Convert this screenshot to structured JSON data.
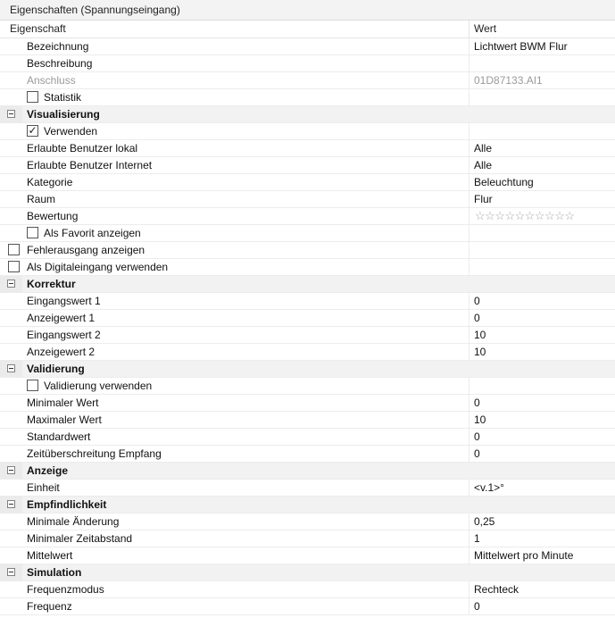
{
  "title": "Eigenschaften (Spannungseingang)",
  "header": {
    "col_property": "Eigenschaft",
    "col_value": "Wert"
  },
  "rows": {
    "bezeichnung": {
      "label": "Bezeichnung",
      "value": "Lichtwert BWM Flur"
    },
    "beschreibung": {
      "label": "Beschreibung",
      "value": ""
    },
    "anschluss": {
      "label": "Anschluss",
      "value": "01D87133.AI1"
    },
    "statistik": {
      "label": "Statistik",
      "checked": false
    },
    "visualisierung": {
      "label": "Visualisierung"
    },
    "verwenden": {
      "label": "Verwenden",
      "checked": true,
      "mark": "✓"
    },
    "benutzer_lokal": {
      "label": "Erlaubte Benutzer lokal",
      "value": "Alle"
    },
    "benutzer_internet": {
      "label": "Erlaubte Benutzer Internet",
      "value": "Alle"
    },
    "kategorie": {
      "label": "Kategorie",
      "value": "Beleuchtung"
    },
    "raum": {
      "label": "Raum",
      "value": "Flur"
    },
    "bewertung": {
      "label": "Bewertung",
      "stars_total": 10,
      "stars_filled": 0,
      "stars": "☆☆☆☆☆☆☆☆☆☆"
    },
    "favorit": {
      "label": "Als Favorit anzeigen",
      "checked": false
    },
    "fehlerausgang": {
      "label": "Fehlerausgang anzeigen",
      "checked": false
    },
    "digitaleingang": {
      "label": "Als Digitaleingang verwenden",
      "checked": false
    },
    "korrektur": {
      "label": "Korrektur"
    },
    "eingangswert1": {
      "label": "Eingangswert 1",
      "value": "0"
    },
    "anzeigewert1": {
      "label": "Anzeigewert 1",
      "value": "0"
    },
    "eingangswert2": {
      "label": "Eingangswert 2",
      "value": "10"
    },
    "anzeigewert2": {
      "label": "Anzeigewert 2",
      "value": "10"
    },
    "validierung": {
      "label": "Validierung"
    },
    "validierung_verwenden": {
      "label": "Validierung verwenden",
      "checked": false
    },
    "minimaler_wert": {
      "label": "Minimaler Wert",
      "value": "0"
    },
    "maximaler_wert": {
      "label": "Maximaler Wert",
      "value": "10"
    },
    "standardwert": {
      "label": "Standardwert",
      "value": "0"
    },
    "zeitueberschreitung": {
      "label": "Zeitüberschreitung Empfang",
      "value": "0"
    },
    "anzeige": {
      "label": "Anzeige"
    },
    "einheit": {
      "label": "Einheit",
      "value": "<v.1>°"
    },
    "empfindlichkeit": {
      "label": "Empfindlichkeit"
    },
    "minimale_aenderung": {
      "label": "Minimale Änderung",
      "value": "0,25"
    },
    "minimaler_zeitabstand": {
      "label": "Minimaler Zeitabstand",
      "value": "1"
    },
    "mittelwert": {
      "label": "Mittelwert",
      "value": "Mittelwert pro Minute"
    },
    "simulation": {
      "label": "Simulation"
    },
    "frequenzmodus": {
      "label": "Frequenzmodus",
      "value": "Rechteck"
    },
    "frequenz": {
      "label": "Frequenz",
      "value": "0"
    }
  },
  "colors": {
    "category_bg": "#f2f2f2",
    "disabled_text": "#9a9a9a",
    "grid_line": "#ececec"
  }
}
